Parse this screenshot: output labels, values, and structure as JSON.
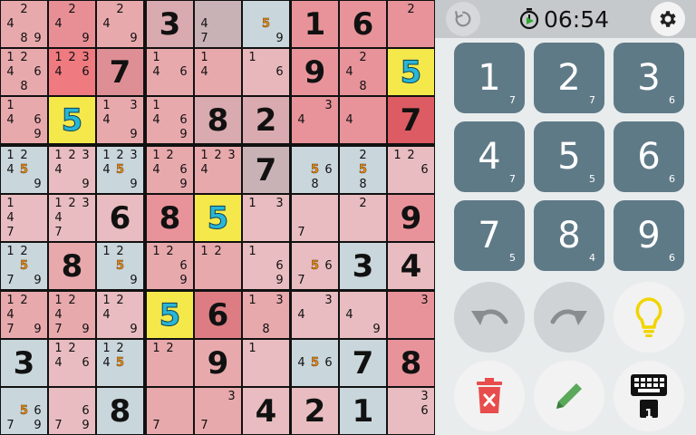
{
  "board": {
    "given": [
      [
        0,
        0,
        0,
        3,
        0,
        0,
        1,
        6,
        0
      ],
      [
        0,
        0,
        7,
        0,
        0,
        0,
        9,
        0,
        0
      ],
      [
        0,
        0,
        0,
        0,
        8,
        2,
        0,
        0,
        7
      ],
      [
        0,
        0,
        0,
        0,
        0,
        7,
        0,
        0,
        0
      ],
      [
        0,
        0,
        6,
        8,
        0,
        0,
        0,
        0,
        9
      ],
      [
        0,
        8,
        0,
        0,
        0,
        0,
        0,
        3,
        4
      ],
      [
        0,
        0,
        0,
        0,
        6,
        0,
        0,
        0,
        0
      ],
      [
        3,
        0,
        0,
        0,
        9,
        0,
        0,
        7,
        8
      ],
      [
        0,
        0,
        8,
        0,
        0,
        4,
        2,
        1,
        0
      ]
    ],
    "placed": [
      [
        0,
        0,
        0,
        0,
        0,
        0,
        0,
        0,
        0
      ],
      [
        0,
        0,
        0,
        0,
        0,
        0,
        0,
        0,
        5
      ],
      [
        0,
        5,
        0,
        0,
        0,
        0,
        0,
        0,
        0
      ],
      [
        0,
        0,
        0,
        0,
        0,
        0,
        0,
        0,
        0
      ],
      [
        0,
        0,
        0,
        0,
        5,
        0,
        0,
        0,
        0
      ],
      [
        0,
        0,
        0,
        0,
        0,
        0,
        0,
        0,
        0
      ],
      [
        0,
        0,
        0,
        5,
        0,
        0,
        0,
        0,
        0
      ],
      [
        0,
        0,
        0,
        0,
        0,
        0,
        0,
        0,
        0
      ],
      [
        0,
        0,
        0,
        0,
        0,
        0,
        0,
        0,
        0
      ]
    ],
    "candidates": [
      [
        [
          2,
          4,
          8,
          9
        ],
        [
          2,
          4,
          9
        ],
        [
          2,
          4,
          9
        ],
        [],
        [
          4,
          7
        ],
        [
          5,
          9
        ],
        [],
        [],
        [
          2
        ]
      ],
      [
        [
          1,
          2,
          4,
          6,
          8
        ],
        [
          1,
          2,
          3,
          4,
          6
        ],
        [],
        [
          1,
          4,
          6
        ],
        [
          1,
          4
        ],
        [
          1,
          6
        ],
        [],
        [
          2,
          4,
          8
        ],
        []
      ],
      [
        [
          1,
          4,
          6,
          9
        ],
        [],
        [
          1,
          3,
          4,
          9
        ],
        [
          1,
          4,
          6,
          9
        ],
        [],
        [],
        [
          3,
          4
        ],
        [
          4
        ],
        []
      ],
      [
        [
          1,
          2,
          4,
          5,
          9
        ],
        [
          1,
          2,
          3,
          4,
          9
        ],
        [
          1,
          2,
          3,
          4,
          5,
          9
        ],
        [
          1,
          2,
          4,
          6,
          9
        ],
        [
          1,
          2,
          3,
          4
        ],
        [],
        [
          5,
          6,
          8
        ],
        [
          2,
          5,
          8
        ],
        [
          1,
          2,
          6
        ]
      ],
      [
        [
          1,
          4,
          7
        ],
        [
          1,
          2,
          3,
          4,
          7
        ],
        [],
        [],
        [],
        [
          1,
          3
        ],
        [
          7
        ],
        [
          2
        ],
        []
      ],
      [
        [
          1,
          2,
          5,
          7,
          9
        ],
        [],
        [
          1,
          2,
          5,
          9
        ],
        [
          1,
          2,
          6,
          9
        ],
        [
          1,
          2
        ],
        [
          1,
          6,
          9
        ],
        [
          5,
          6,
          7
        ],
        [],
        []
      ],
      [
        [
          1,
          2,
          4,
          7,
          9
        ],
        [
          1,
          2,
          4,
          7,
          9
        ],
        [
          1,
          2,
          4,
          9
        ],
        [],
        [],
        [
          1,
          3,
          8
        ],
        [
          3,
          4
        ],
        [
          4,
          9
        ],
        [
          3
        ]
      ],
      [
        [],
        [
          1,
          2,
          4,
          6
        ],
        [
          1,
          2,
          4,
          5
        ],
        [
          1,
          2
        ],
        [],
        [
          1
        ],
        [
          4,
          5,
          6
        ],
        [],
        []
      ],
      [
        [
          5,
          6,
          7,
          9
        ],
        [
          6,
          7,
          9
        ],
        [],
        [
          7
        ],
        [
          3,
          7
        ],
        [],
        [],
        [],
        [
          3,
          6
        ]
      ]
    ],
    "highlight_digit": 5,
    "cell_colors": [
      [
        "#e8a9ad",
        "#e88f96",
        "#e8a9ad",
        "#d9aaaf",
        "#c9b2b6",
        "#c9d6dc",
        "#e8939a",
        "#e8939a",
        "#e8939a"
      ],
      [
        "#e8a9ad",
        "#ef7a80",
        "#dd8f95",
        "#e8a9ad",
        "#e8a9ad",
        "#e8b7bb",
        "#e8939a",
        "#e8939a",
        "#f5e84a"
      ],
      [
        "#e8a9ad",
        "#f5e84a",
        "#e8a9ad",
        "#e8a9ad",
        "#d9aaaf",
        "#d9aaaf",
        "#e8939a",
        "#e8939a",
        "#dd5b62"
      ],
      [
        "#c9d6dc",
        "#e8bcc0",
        "#c9d6dc",
        "#e8a9ad",
        "#e8a9ad",
        "#c9b2b6",
        "#c9d6dc",
        "#c9d6dc",
        "#e8bcc0"
      ],
      [
        "#e8bcc0",
        "#e8bcc0",
        "#e8bcc0",
        "#e8939a",
        "#f5e84a",
        "#e8bcc0",
        "#e8bcc0",
        "#e8bcc0",
        "#e8939a"
      ],
      [
        "#c9d6dc",
        "#e8a9ad",
        "#c9d6dc",
        "#e8a9ad",
        "#e8a9ad",
        "#e8bcc0",
        "#e8bcc0",
        "#c9d6dc",
        "#e8bcc0"
      ],
      [
        "#e8a9ad",
        "#e8a9ad",
        "#e8bcc0",
        "#f5e84a",
        "#dd7d83",
        "#e8a9ad",
        "#e8bcc0",
        "#e8bcc0",
        "#e8939a"
      ],
      [
        "#c9d6dc",
        "#e8bcc0",
        "#c9d6dc",
        "#e8a9ad",
        "#e8a9ad",
        "#e8bcc0",
        "#c9d6dc",
        "#c9d6dc",
        "#e8939a"
      ],
      [
        "#c9d6dc",
        "#e8bcc0",
        "#c9d6dc",
        "#e8a9ad",
        "#e8a9ad",
        "#e8bcc0",
        "#e8bcc0",
        "#c9d6dc",
        "#e8bcc0"
      ]
    ]
  },
  "timer": "06:54",
  "numpad": [
    {
      "digit": "1",
      "count": "7"
    },
    {
      "digit": "2",
      "count": "7"
    },
    {
      "digit": "3",
      "count": "6"
    },
    {
      "digit": "4",
      "count": "7"
    },
    {
      "digit": "5",
      "count": "5"
    },
    {
      "digit": "6",
      "count": "6"
    },
    {
      "digit": "7",
      "count": "5"
    },
    {
      "digit": "8",
      "count": "4"
    },
    {
      "digit": "9",
      "count": "6"
    }
  ],
  "keyboard_badge": "1",
  "icons": {
    "refresh": "refresh-icon",
    "timer": "stopwatch-icon",
    "settings": "gear-icon",
    "undo": "undo-icon",
    "redo": "redo-icon",
    "hint": "lightbulb-icon",
    "erase": "trash-icon",
    "pencil": "pencil-icon",
    "keyboard": "keyboard-icon"
  },
  "colors": {
    "numpad_bg": "#5f7a87",
    "hint_yellow": "#f5e84a",
    "erase_red": "#e84c4c",
    "pencil_green": "#5aa85a"
  }
}
